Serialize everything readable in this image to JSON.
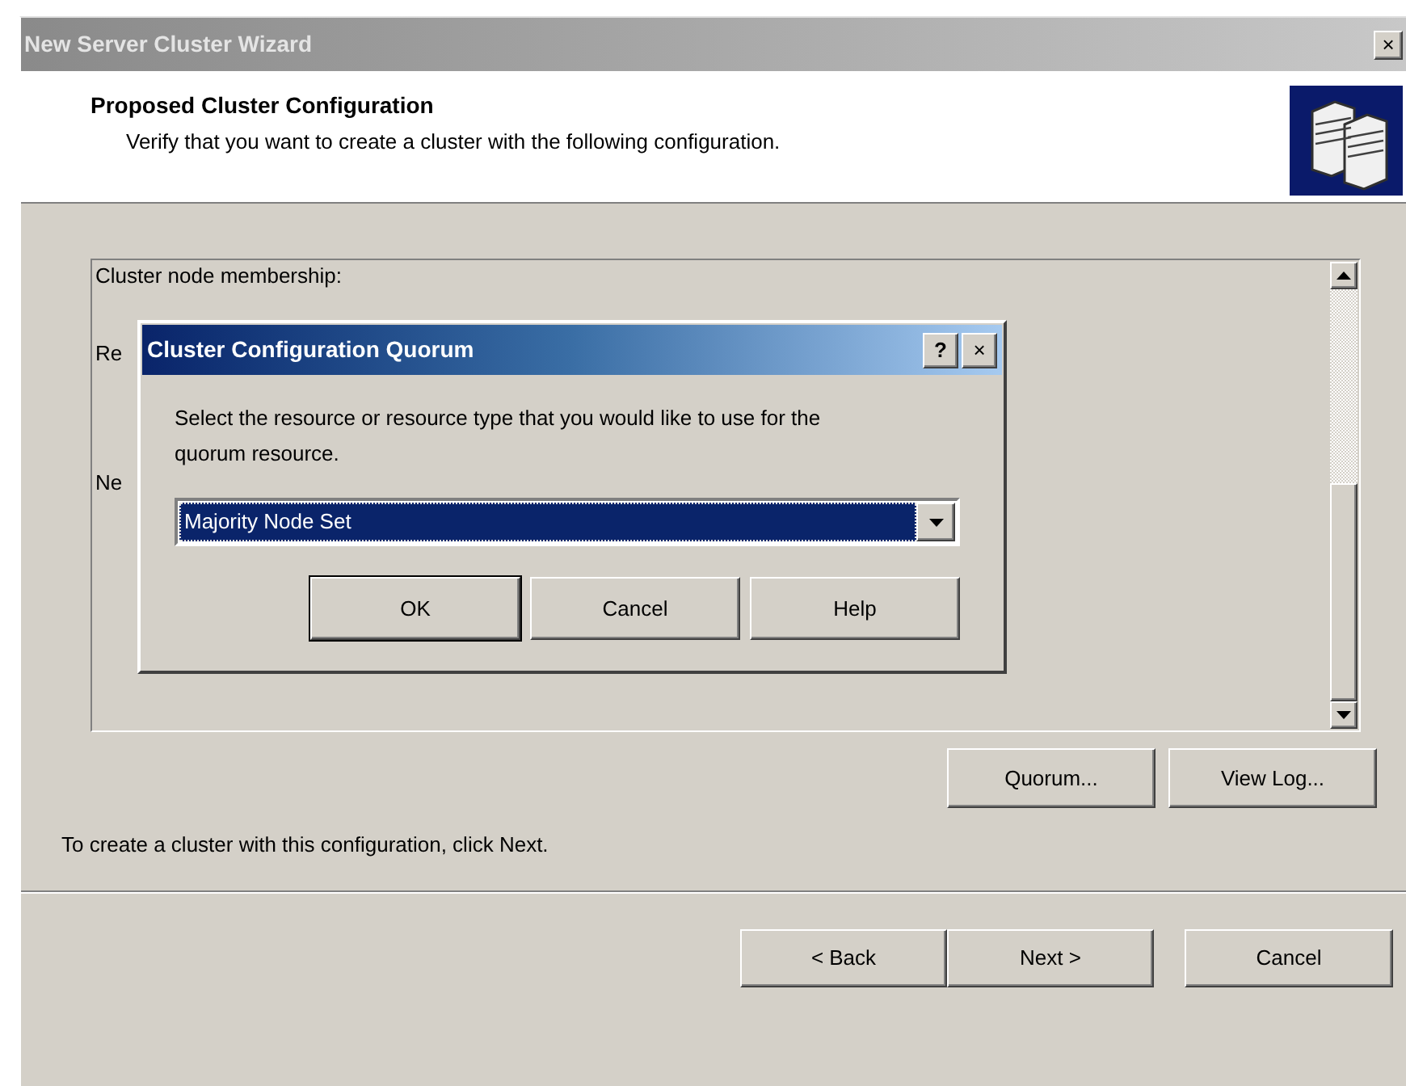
{
  "window": {
    "title": "New Server Cluster Wizard",
    "close": "×"
  },
  "header": {
    "title": "Proposed Cluster Configuration",
    "subtitle": "Verify that you want to create a cluster with the following configuration."
  },
  "listbox": {
    "lines": [
      "Cluster node membership:",
      "Re",
      "Ne"
    ]
  },
  "dialog": {
    "title": "Cluster Configuration Quorum",
    "help": "?",
    "close": "×",
    "prompt": "Select the resource or resource type that you would like to use for the quorum resource.",
    "combo": {
      "value": "Majority Node Set",
      "selected": true
    },
    "buttons": [
      {
        "label": "OK",
        "default": true
      },
      {
        "label": "Cancel",
        "default": false
      },
      {
        "label": "Help",
        "default": false
      }
    ]
  },
  "side_buttons": [
    "Quorum...",
    "View Log..."
  ],
  "footer_text": "To create a cluster with this configuration, click Next.",
  "nav_buttons": [
    "< Back",
    "Next >",
    "Cancel"
  ]
}
